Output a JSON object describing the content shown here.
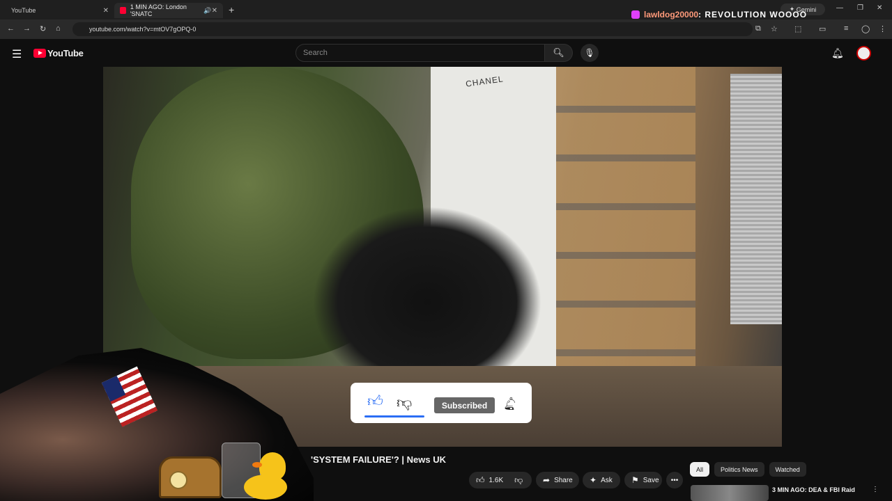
{
  "browser": {
    "tabs": [
      {
        "label": "YouTube"
      },
      {
        "label": "1 MIN AGO: London 'SNATC"
      }
    ],
    "gemini_label": "Gemini",
    "url": "youtube.com/watch?v=mtOV7gOPQ-0"
  },
  "youtube": {
    "logo_text": "YouTube",
    "search_placeholder": "Search"
  },
  "stream_overlay": {
    "chat_user": "lawldog20000",
    "chat_message": ": REVOLUTION WOOOO",
    "video_sign": "CHANEL",
    "subscribed_label": "Subscribed"
  },
  "video": {
    "title": "'SYSTEM FAILURE'? | News UK",
    "like_count": "1.6K",
    "share_label": "Share",
    "ask_label": "Ask",
    "save_label": "Save"
  },
  "sidebar": {
    "chips": [
      "All",
      "Politics News",
      "Watched"
    ],
    "recommendation_title": "3 MIN AGO: DEA & FBI Raid"
  },
  "colors": {
    "brand_red": "#ff0033",
    "like_blue": "#2a6df4",
    "chat_user": "#ff9a7a"
  }
}
